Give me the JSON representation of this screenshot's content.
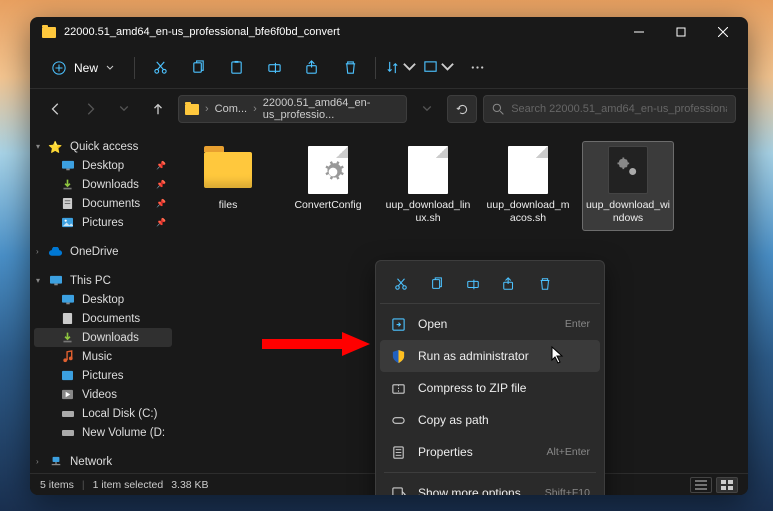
{
  "title": "22000.51_amd64_en-us_professional_bfe6f0bd_convert",
  "toolbar": {
    "new_label": "New"
  },
  "breadcrumb": {
    "seg1": "Com...",
    "seg2": "22000.51_amd64_en-us_professio..."
  },
  "search": {
    "placeholder": "Search 22000.51_amd64_en-us_professional_bfe6f0b..."
  },
  "sidebar": {
    "quick_access": "Quick access",
    "desktop": "Desktop",
    "downloads": "Downloads",
    "documents": "Documents",
    "pictures": "Pictures",
    "onedrive": "OneDrive",
    "this_pc": "This PC",
    "pc_desktop": "Desktop",
    "pc_documents": "Documents",
    "pc_downloads": "Downloads",
    "pc_music": "Music",
    "pc_pictures": "Pictures",
    "pc_videos": "Videos",
    "pc_localdisk": "Local Disk (C:)",
    "pc_newvol": "New Volume (D:",
    "network": "Network"
  },
  "files": {
    "f1": "files",
    "f2": "ConvertConfig",
    "f3": "uup_download_linux.sh",
    "f4": "uup_download_macos.sh",
    "f5": "uup_download_windows"
  },
  "ctx": {
    "open": "Open",
    "open_sc": "Enter",
    "admin": "Run as administrator",
    "zip": "Compress to ZIP file",
    "copy_path": "Copy as path",
    "props": "Properties",
    "props_sc": "Alt+Enter",
    "more": "Show more options",
    "more_sc": "Shift+F10"
  },
  "status": {
    "items": "5 items",
    "selected": "1 item selected",
    "size": "3.38 KB"
  }
}
